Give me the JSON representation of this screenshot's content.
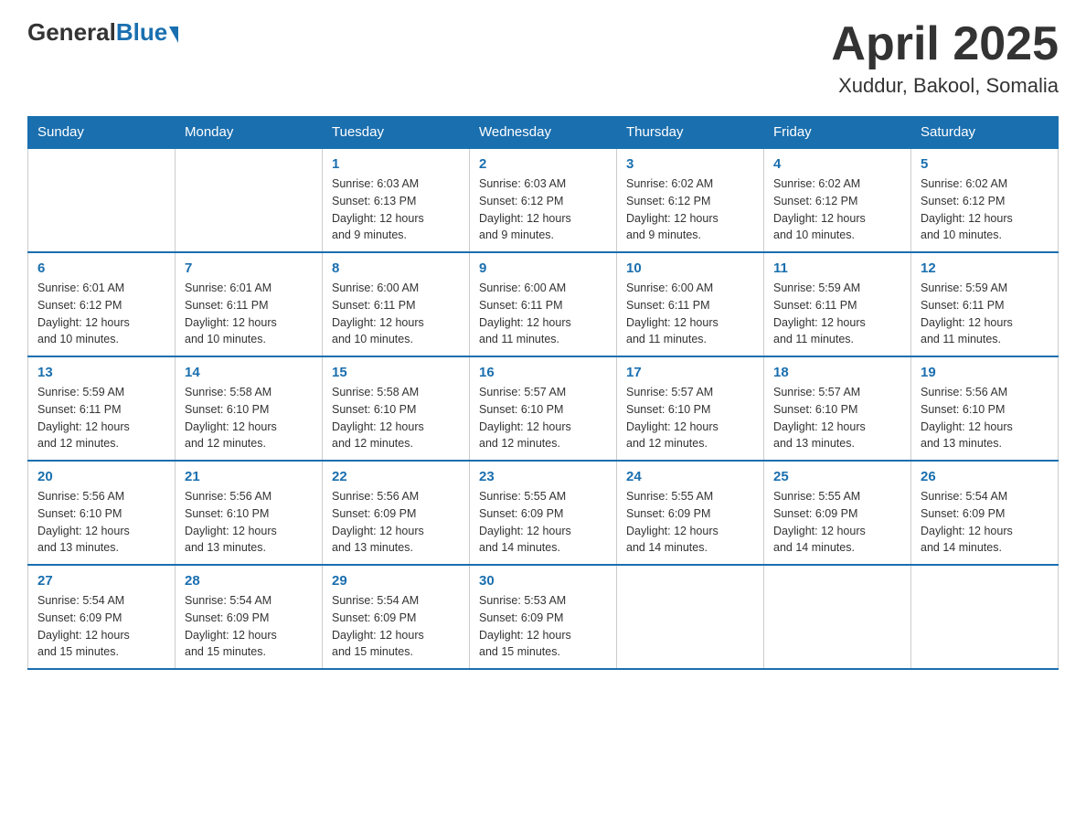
{
  "logo": {
    "general": "General",
    "blue": "Blue"
  },
  "title": {
    "month_year": "April 2025",
    "location": "Xuddur, Bakool, Somalia"
  },
  "days_of_week": [
    "Sunday",
    "Monday",
    "Tuesday",
    "Wednesday",
    "Thursday",
    "Friday",
    "Saturday"
  ],
  "weeks": [
    [
      {
        "day": "",
        "info": ""
      },
      {
        "day": "",
        "info": ""
      },
      {
        "day": "1",
        "info": "Sunrise: 6:03 AM\nSunset: 6:13 PM\nDaylight: 12 hours\nand 9 minutes."
      },
      {
        "day": "2",
        "info": "Sunrise: 6:03 AM\nSunset: 6:12 PM\nDaylight: 12 hours\nand 9 minutes."
      },
      {
        "day": "3",
        "info": "Sunrise: 6:02 AM\nSunset: 6:12 PM\nDaylight: 12 hours\nand 9 minutes."
      },
      {
        "day": "4",
        "info": "Sunrise: 6:02 AM\nSunset: 6:12 PM\nDaylight: 12 hours\nand 10 minutes."
      },
      {
        "day": "5",
        "info": "Sunrise: 6:02 AM\nSunset: 6:12 PM\nDaylight: 12 hours\nand 10 minutes."
      }
    ],
    [
      {
        "day": "6",
        "info": "Sunrise: 6:01 AM\nSunset: 6:12 PM\nDaylight: 12 hours\nand 10 minutes."
      },
      {
        "day": "7",
        "info": "Sunrise: 6:01 AM\nSunset: 6:11 PM\nDaylight: 12 hours\nand 10 minutes."
      },
      {
        "day": "8",
        "info": "Sunrise: 6:00 AM\nSunset: 6:11 PM\nDaylight: 12 hours\nand 10 minutes."
      },
      {
        "day": "9",
        "info": "Sunrise: 6:00 AM\nSunset: 6:11 PM\nDaylight: 12 hours\nand 11 minutes."
      },
      {
        "day": "10",
        "info": "Sunrise: 6:00 AM\nSunset: 6:11 PM\nDaylight: 12 hours\nand 11 minutes."
      },
      {
        "day": "11",
        "info": "Sunrise: 5:59 AM\nSunset: 6:11 PM\nDaylight: 12 hours\nand 11 minutes."
      },
      {
        "day": "12",
        "info": "Sunrise: 5:59 AM\nSunset: 6:11 PM\nDaylight: 12 hours\nand 11 minutes."
      }
    ],
    [
      {
        "day": "13",
        "info": "Sunrise: 5:59 AM\nSunset: 6:11 PM\nDaylight: 12 hours\nand 12 minutes."
      },
      {
        "day": "14",
        "info": "Sunrise: 5:58 AM\nSunset: 6:10 PM\nDaylight: 12 hours\nand 12 minutes."
      },
      {
        "day": "15",
        "info": "Sunrise: 5:58 AM\nSunset: 6:10 PM\nDaylight: 12 hours\nand 12 minutes."
      },
      {
        "day": "16",
        "info": "Sunrise: 5:57 AM\nSunset: 6:10 PM\nDaylight: 12 hours\nand 12 minutes."
      },
      {
        "day": "17",
        "info": "Sunrise: 5:57 AM\nSunset: 6:10 PM\nDaylight: 12 hours\nand 12 minutes."
      },
      {
        "day": "18",
        "info": "Sunrise: 5:57 AM\nSunset: 6:10 PM\nDaylight: 12 hours\nand 13 minutes."
      },
      {
        "day": "19",
        "info": "Sunrise: 5:56 AM\nSunset: 6:10 PM\nDaylight: 12 hours\nand 13 minutes."
      }
    ],
    [
      {
        "day": "20",
        "info": "Sunrise: 5:56 AM\nSunset: 6:10 PM\nDaylight: 12 hours\nand 13 minutes."
      },
      {
        "day": "21",
        "info": "Sunrise: 5:56 AM\nSunset: 6:10 PM\nDaylight: 12 hours\nand 13 minutes."
      },
      {
        "day": "22",
        "info": "Sunrise: 5:56 AM\nSunset: 6:09 PM\nDaylight: 12 hours\nand 13 minutes."
      },
      {
        "day": "23",
        "info": "Sunrise: 5:55 AM\nSunset: 6:09 PM\nDaylight: 12 hours\nand 14 minutes."
      },
      {
        "day": "24",
        "info": "Sunrise: 5:55 AM\nSunset: 6:09 PM\nDaylight: 12 hours\nand 14 minutes."
      },
      {
        "day": "25",
        "info": "Sunrise: 5:55 AM\nSunset: 6:09 PM\nDaylight: 12 hours\nand 14 minutes."
      },
      {
        "day": "26",
        "info": "Sunrise: 5:54 AM\nSunset: 6:09 PM\nDaylight: 12 hours\nand 14 minutes."
      }
    ],
    [
      {
        "day": "27",
        "info": "Sunrise: 5:54 AM\nSunset: 6:09 PM\nDaylight: 12 hours\nand 15 minutes."
      },
      {
        "day": "28",
        "info": "Sunrise: 5:54 AM\nSunset: 6:09 PM\nDaylight: 12 hours\nand 15 minutes."
      },
      {
        "day": "29",
        "info": "Sunrise: 5:54 AM\nSunset: 6:09 PM\nDaylight: 12 hours\nand 15 minutes."
      },
      {
        "day": "30",
        "info": "Sunrise: 5:53 AM\nSunset: 6:09 PM\nDaylight: 12 hours\nand 15 minutes."
      },
      {
        "day": "",
        "info": ""
      },
      {
        "day": "",
        "info": ""
      },
      {
        "day": "",
        "info": ""
      }
    ]
  ]
}
